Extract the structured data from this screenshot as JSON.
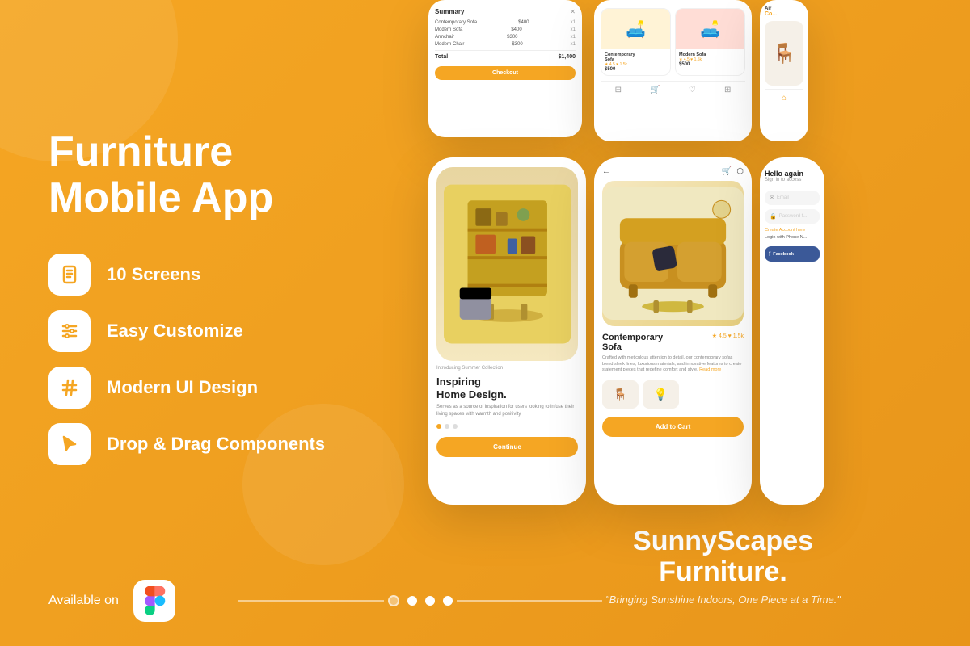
{
  "background": {
    "gradient_start": "#F5A623",
    "gradient_end": "#E8951A"
  },
  "title": "Furniture Mobile App",
  "features": [
    {
      "id": "screens",
      "icon": "document",
      "label": "10 Screens"
    },
    {
      "id": "customize",
      "icon": "sliders",
      "label": "Easy Customize"
    },
    {
      "id": "ui-design",
      "icon": "hashtag",
      "label": "Modern UI Design"
    },
    {
      "id": "drag-drop",
      "icon": "cursor",
      "label": "Drop & Drag Components"
    }
  ],
  "available_on": "Available on",
  "brand": {
    "name": "SunnyScapes\nFurniture.",
    "tagline": "\"Bringing Sunshine Indoors, One Piece at a Time.\""
  },
  "dots": {
    "count": 4,
    "active": 1
  },
  "phone_screens": {
    "order_summary": {
      "title": "Summary",
      "items": [
        {
          "name": "Contemporary Sofa",
          "price": "$400",
          "qty": "x1"
        },
        {
          "name": "Modern Sofa",
          "price": "$400",
          "qty": "x1"
        },
        {
          "name": "Armchair",
          "price": "$300",
          "qty": "x1"
        },
        {
          "name": "Modern Chair",
          "price": "$300",
          "qty": "x1"
        }
      ],
      "total_label": "Total",
      "total_value": "$1,400",
      "checkout_btn": "Checkout"
    },
    "product_listing": {
      "products": [
        {
          "name": "Contemporary Sofa",
          "rating": "4.5",
          "likes": "1.5k",
          "price": "$500",
          "bg": "yellow"
        },
        {
          "name": "Modern Sofa",
          "rating": "4.5",
          "likes": "1.5k",
          "price": "$500",
          "bg": "red"
        }
      ]
    },
    "onboarding": {
      "tag": "Introducing Summer Collection",
      "heading": "Inspiring\nHome Design.",
      "subtext": "Serves as a source of inspiration for users looking to infuse their living spaces with warmth and positivity.",
      "continue_btn": "Continue",
      "dots_count": 3,
      "active_dot": 0
    },
    "product_detail": {
      "product_name": "Contemporary\nSofa",
      "rating": "4.5",
      "likes": "1.5k",
      "description": "Crafted with meticulous attention to detail, our contemporary sofas blend sleek lines, luxurious materials, and innovative features to create statement pieces that redefine comfort and style.",
      "read_more": "Read more",
      "add_cart_btn": "Add to Cart"
    },
    "login": {
      "hello": "Hello again",
      "signin_prompt": "Sign in to access",
      "email_label": "Email",
      "password_label": "Password f...",
      "create_account": "Create Account here",
      "login_phone": "Login with Phone N...",
      "facebook_label": "Facebook"
    }
  }
}
